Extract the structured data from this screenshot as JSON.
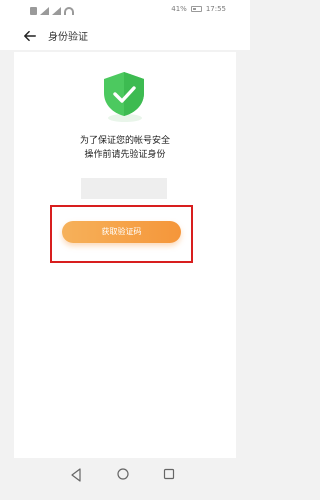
{
  "status_bar": {
    "battery": "41%",
    "time": "17:55"
  },
  "header": {
    "title": "身份验证",
    "back_icon": "arrow-left-icon"
  },
  "main": {
    "shield_icon": "shield-check-icon",
    "shield_color": "#4CC95F",
    "message_line1": "为了保证您的帐号安全",
    "message_line2": "操作前请先验证身份",
    "phone_field_value": "",
    "get_code_label": "获取验证码",
    "button_gradient": [
      "#F6B15A",
      "#F5963A"
    ],
    "highlight_border_color": "#D81E1E"
  },
  "nav_bar": {
    "back_icon": "triangle-back-icon",
    "home_icon": "circle-home-icon",
    "recents_icon": "square-recents-icon"
  }
}
